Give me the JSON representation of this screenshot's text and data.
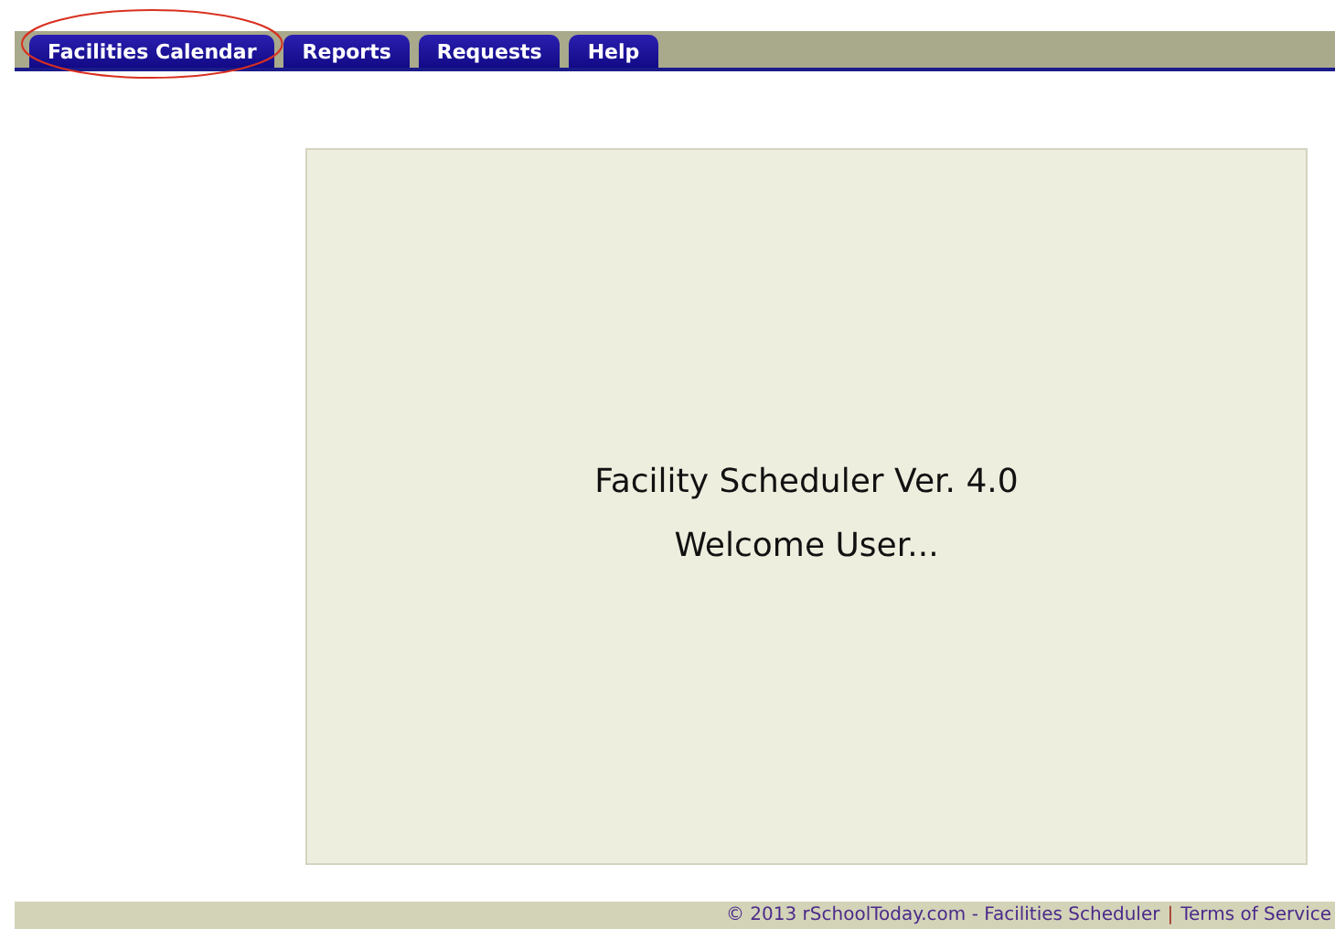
{
  "tabs": [
    {
      "label": "Facilities Calendar",
      "circled": true
    },
    {
      "label": "Reports",
      "circled": false
    },
    {
      "label": "Requests",
      "circled": false
    },
    {
      "label": "Help",
      "circled": false
    }
  ],
  "welcome": {
    "title": "Facility Scheduler Ver. 4.0",
    "greeting": "Welcome User..."
  },
  "footer": {
    "copyright": "© 2013 rSchoolToday.com - Facilities Scheduler",
    "separator": "|",
    "link": "Terms of Service"
  }
}
